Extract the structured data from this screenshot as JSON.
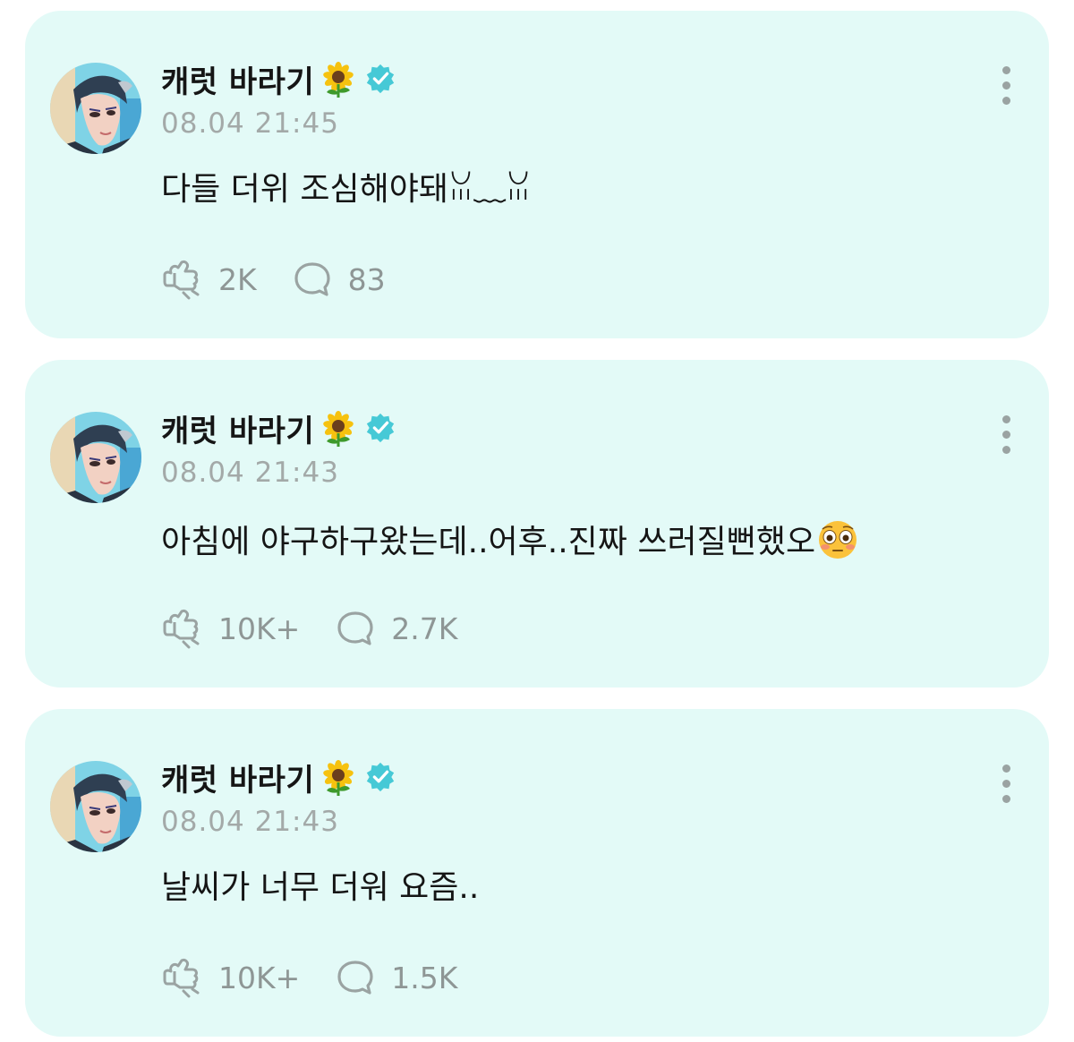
{
  "posts": [
    {
      "author": "캐럿 바라기",
      "timestamp": "08.04 21:45",
      "text": "다들 더위 조심해야돼ꈍ﹏ꈍ",
      "emoji": "",
      "likes": "2K",
      "comments": "83"
    },
    {
      "author": "캐럿 바라기",
      "timestamp": "08.04 21:43",
      "text": "아침에 야구하구왔는데..어후..진짜 쓰러질뻔했오",
      "emoji": "flushed-face",
      "likes": "10K+",
      "comments": "2.7K"
    },
    {
      "author": "캐럿 바라기",
      "timestamp": "08.04 21:43",
      "text": "날씨가 너무 더워 요즘..",
      "emoji": "",
      "likes": "10K+",
      "comments": "1.5K"
    }
  ],
  "icons": {
    "name_emoji": "sunflower-icon",
    "verified": "verified-badge-icon",
    "like": "like-icon",
    "comment": "comment-icon",
    "menu": "more-vertical-icon"
  },
  "colors": {
    "card_background": "#e3faf7",
    "verified_badge": "#46c9d6",
    "timestamp": "#a3a9a8",
    "action_icon": "#9aa3a2"
  }
}
